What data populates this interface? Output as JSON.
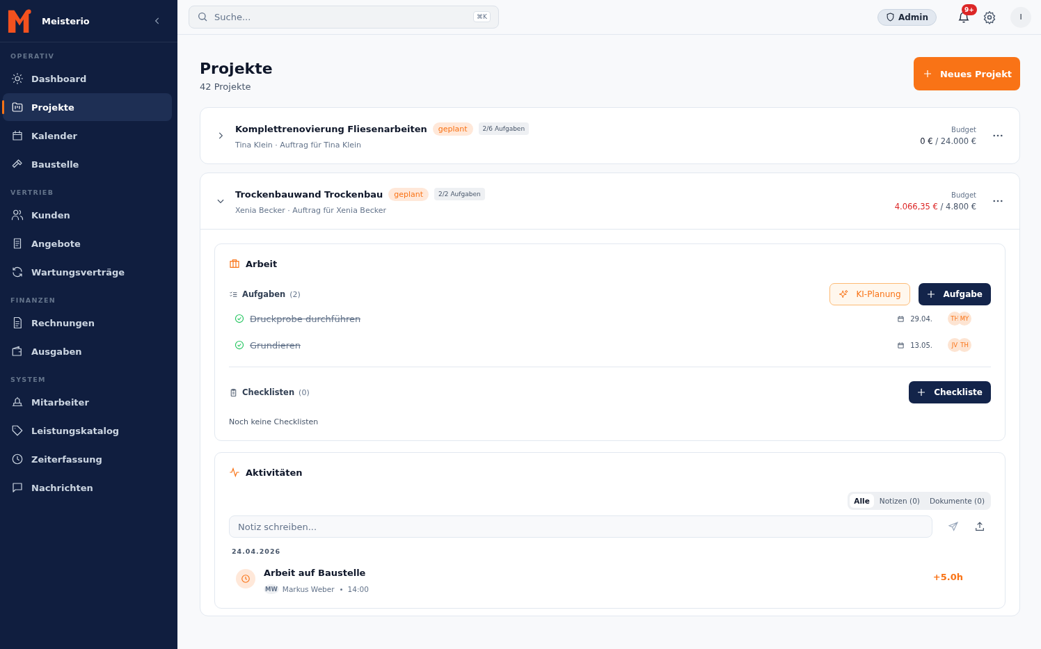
{
  "brand": {
    "name": "Meisterio"
  },
  "sidebar": {
    "sections": [
      {
        "title": "OPERATIV",
        "items": [
          {
            "label": "Dashboard",
            "selected": false
          },
          {
            "label": "Projekte",
            "selected": true
          },
          {
            "label": "Kalender",
            "selected": false
          },
          {
            "label": "Baustelle",
            "selected": false
          }
        ]
      },
      {
        "title": "VERTRIEB",
        "items": [
          {
            "label": "Kunden",
            "selected": false
          },
          {
            "label": "Angebote",
            "selected": false
          },
          {
            "label": "Wartungsverträge",
            "selected": false
          }
        ]
      },
      {
        "title": "FINANZEN",
        "items": [
          {
            "label": "Rechnungen",
            "selected": false
          },
          {
            "label": "Ausgaben",
            "selected": false
          }
        ]
      },
      {
        "title": "SYSTEM",
        "items": [
          {
            "label": "Mitarbeiter",
            "selected": false
          },
          {
            "label": "Leistungskatalog",
            "selected": false
          },
          {
            "label": "Zeiterfassung",
            "selected": false
          },
          {
            "label": "Nachrichten",
            "selected": false
          }
        ]
      }
    ]
  },
  "topbar": {
    "search": {
      "placeholder": "Suche...",
      "shortcut": "⌘K"
    },
    "role": "Admin",
    "notifications": "9+",
    "avatar": "I"
  },
  "page": {
    "title": "Projekte",
    "subtitle": "42 Projekte",
    "new_button": "Neues Projekt"
  },
  "projects": [
    {
      "title": "Komplettrenovierung Fliesenarbeiten",
      "status": "geplant",
      "tasks_badge": "2/6 Aufgaben",
      "subtitle": "Tina Klein · Auftrag für Tina Klein",
      "budget_label": "Budget",
      "spent": "0 €",
      "spent_warning": false,
      "budget": "/ 24.000 €",
      "expanded": false
    },
    {
      "title": "Trockenbauwand Trockenbau",
      "status": "geplant",
      "tasks_badge": "2/2 Aufgaben",
      "subtitle": "Xenia Becker · Auftrag für Xenia Becker",
      "budget_label": "Budget",
      "spent": "4.066,35 €",
      "spent_warning": true,
      "budget": "/ 4.800 €",
      "expanded": true,
      "work": {
        "title": "Arbeit",
        "tasks_label": "Aufgaben",
        "tasks_count": "(2)",
        "ai_button": "KI-Planung",
        "add_task_button": "Aufgabe",
        "tasks": [
          {
            "title": "Druckprobe durchführen",
            "done": true,
            "date": "29.04.",
            "assignees": [
              "TH",
              "MY"
            ]
          },
          {
            "title": "Grundieren",
            "done": true,
            "date": "13.05.",
            "assignees": [
              "JV",
              "TH"
            ]
          }
        ],
        "checklists_label": "Checklisten",
        "checklists_count": "(0)",
        "add_checklist_button": "Checkliste",
        "checklists_empty": "Noch keine Checklisten"
      },
      "activity": {
        "title": "Aktivitäten",
        "tabs": [
          {
            "label": "Alle",
            "selected": true
          },
          {
            "label": "Notizen (0)",
            "selected": false
          },
          {
            "label": "Dokumente (0)",
            "selected": false
          }
        ],
        "note_placeholder": "Notiz schreiben...",
        "groups": [
          {
            "date": "24.04.2026",
            "entries": [
              {
                "title": "Arbeit auf Baustelle",
                "initials": "MW",
                "author": "Markus Weber",
                "time": "14:00",
                "amount": "+5.0h"
              }
            ]
          }
        ]
      }
    }
  ]
}
